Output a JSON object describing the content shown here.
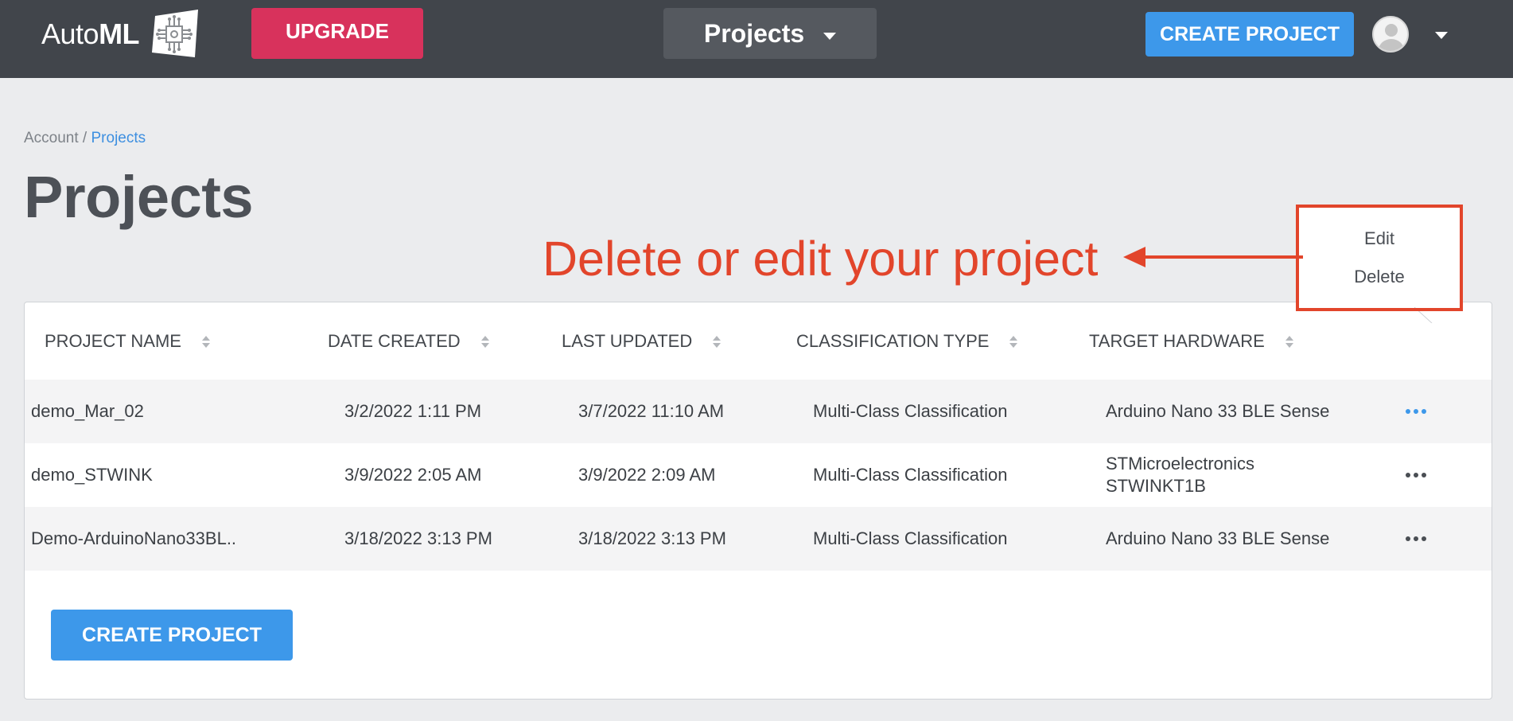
{
  "header": {
    "logo_text_light": "Auto",
    "logo_text_bold": "ML",
    "upgrade_label": "UPGRADE",
    "project_selector_label": "Projects",
    "create_project_label": "CREATE PROJECT",
    "logo_icon": "circuit-chip-icon",
    "avatar_icon": "user-avatar-icon"
  },
  "breadcrumb": {
    "parent": "Account",
    "separator": " / ",
    "current": "Projects"
  },
  "page": {
    "title": "Projects"
  },
  "annotation": {
    "text": "Delete or edit your project",
    "color": "#e2452b"
  },
  "table": {
    "columns": [
      "PROJECT NAME",
      "DATE CREATED",
      "LAST UPDATED",
      "CLASSIFICATION TYPE",
      "TARGET HARDWARE"
    ],
    "rows": [
      {
        "name": "demo_Mar_02",
        "created": "3/2/2022 1:11 PM",
        "updated": "3/7/2022 11:10 AM",
        "classification": "Multi-Class Classification",
        "hardware": "Arduino Nano 33 BLE Sense"
      },
      {
        "name": "demo_STWINK",
        "created": "3/9/2022 2:05 AM",
        "updated": "3/9/2022 2:09 AM",
        "classification": "Multi-Class Classification",
        "hardware": "STMicroelectronics STWINKT1B"
      },
      {
        "name": "Demo-ArduinoNano33BL..",
        "created": "3/18/2022 3:13 PM",
        "updated": "3/18/2022 3:13 PM",
        "classification": "Multi-Class Classification",
        "hardware": "Arduino Nano 33 BLE Sense"
      }
    ],
    "row_menu": {
      "edit": "Edit",
      "delete": "Delete"
    }
  },
  "footer": {
    "create_project_label": "CREATE PROJECT"
  },
  "colors": {
    "topbar": "#41454b",
    "upgrade": "#d8325c",
    "primary": "#3d98ea",
    "link": "#3d8fe0",
    "annotation": "#e2452b"
  }
}
